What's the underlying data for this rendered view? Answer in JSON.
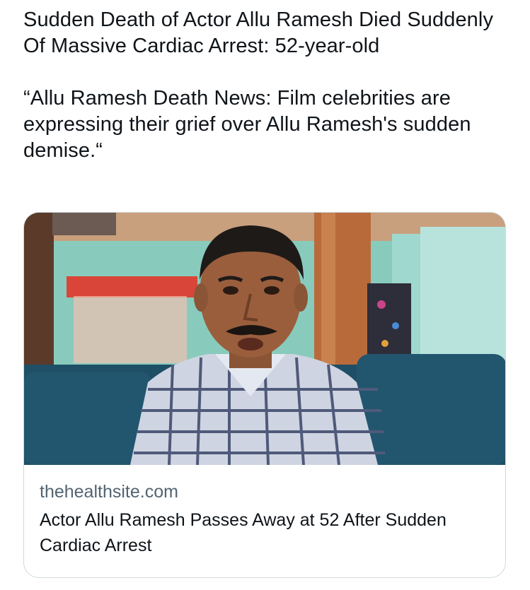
{
  "tweet": {
    "paragraph_1": "Sudden Death of Actor Allu Ramesh Died Suddenly Of Massive Cardiac Arrest: 52-year-old",
    "paragraph_2": "“Allu Ramesh Death News: Film celebrities are expressing their grief over Allu Ramesh's sudden demise.“"
  },
  "link_card": {
    "domain": "thehealthsite.com",
    "title": "Actor Allu Ramesh Passes Away at 52 After Sudden Cardiac Arrest"
  }
}
